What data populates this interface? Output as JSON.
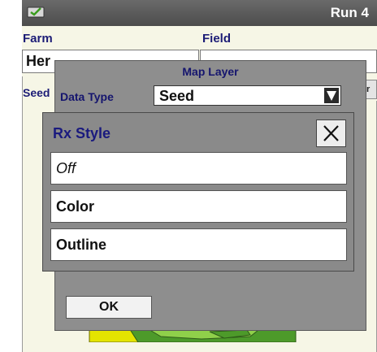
{
  "titlebar": {
    "run_label": "Run 4",
    "logo_icon": "monitor-check-icon"
  },
  "background": {
    "farm_label": "Farm",
    "field_label": "Field",
    "farm_value": "Her",
    "seed_label": "Seed",
    "layer_button": "ayer"
  },
  "map_layer": {
    "title": "Map Layer",
    "data_type_label": "Data Type",
    "data_type_value": "Seed",
    "ok_label": "OK"
  },
  "rx_style": {
    "title": "Rx Style",
    "options": [
      {
        "label": "Off"
      },
      {
        "label": "Color"
      },
      {
        "label": "Outline"
      }
    ]
  },
  "colors": {
    "title_bar": "#5a5a5a",
    "dialog_label": "#15156e",
    "dialog_bg": "#8e8e8e",
    "map_yellow": "#e4e400",
    "map_green_dark": "#4d9a2a",
    "map_green_light": "#8fd04a"
  }
}
